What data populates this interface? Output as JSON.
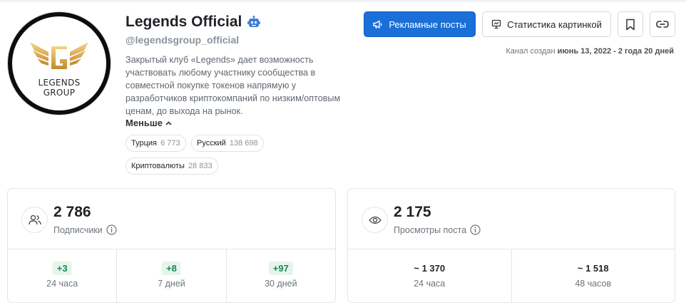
{
  "channel": {
    "title": "Legends Official",
    "handle": "@legendsgroup_official",
    "description": "Закрытый клуб «Legends» дает возможность участвовать любому участнику сообщества в совместной покупке токенов напрямую у разработчиков криптокомпаний по низким/оптовым ценам, до выхода на рынок.",
    "less_label": "Меньше",
    "avatar": {
      "line1": "LEGENDS",
      "line2": "GROUP"
    },
    "tags": [
      {
        "name": "Турция",
        "count": "6 773"
      },
      {
        "name": "Русский",
        "count": "138 698"
      },
      {
        "name": "Криптовалюты",
        "count": "28 833"
      }
    ]
  },
  "actions": {
    "ad_posts": "Рекламные посты",
    "image_stats": "Статистика картинкой",
    "created_prefix": "Канал создан",
    "created_value": "июнь 13, 2022 - 2 года 20 дней"
  },
  "subscribers": {
    "value": "2 786",
    "label": "Подписчики",
    "stats": [
      {
        "delta": "+3",
        "period": "24 часа"
      },
      {
        "delta": "+8",
        "period": "7 дней"
      },
      {
        "delta": "+97",
        "period": "30 дней"
      }
    ]
  },
  "views": {
    "value": "2 175",
    "label": "Просмотры поста",
    "stats": [
      {
        "value": "~ 1 370",
        "period": "24 часа"
      },
      {
        "value": "~ 1 518",
        "period": "48 часов"
      }
    ]
  },
  "colors": {
    "primary": "#1a6fd8",
    "positive": "#198754",
    "positive_bg": "#e6f5ec",
    "robot": "#3d7fd6"
  },
  "icons": [
    "robot-icon",
    "megaphone-icon",
    "presentation-chart-icon",
    "bookmark-icon",
    "link-icon",
    "users-icon",
    "eye-icon",
    "info-icon",
    "chevron-up-icon"
  ]
}
